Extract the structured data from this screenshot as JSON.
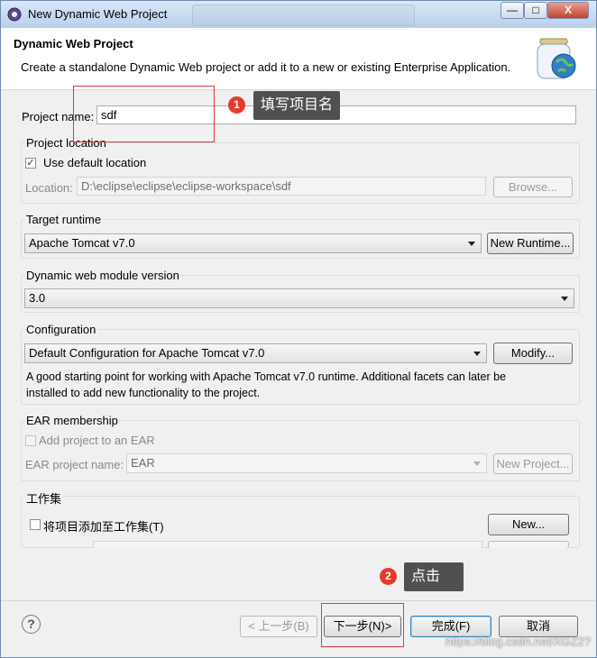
{
  "window": {
    "title": "New Dynamic Web Project",
    "minimize": "—",
    "maximize": "□",
    "close": "X"
  },
  "header": {
    "title": "Dynamic Web Project",
    "description": "Create a standalone Dynamic Web project or add it to a new or existing Enterprise Application."
  },
  "project_name": {
    "label": "Project name:",
    "value": "sdf"
  },
  "project_location": {
    "label": "Project location",
    "use_default_label": "Use default location",
    "use_default_checked": true,
    "location_label": "Location:",
    "location_value": "D:\\eclipse\\eclipse\\eclipse-workspace\\sdf",
    "browse_label": "Browse..."
  },
  "target_runtime": {
    "label": "Target runtime",
    "selected": "Apache Tomcat v7.0",
    "new_runtime_label": "New Runtime..."
  },
  "module_version": {
    "label": "Dynamic web module version",
    "selected": "3.0"
  },
  "configuration": {
    "label": "Configuration",
    "selected": "Default Configuration for Apache Tomcat v7.0",
    "modify_label": "Modify...",
    "description_line1": "A good starting point for working with Apache Tomcat v7.0 runtime. Additional facets can later be",
    "description_line2": "installed to add new functionality to the project."
  },
  "ear": {
    "label": "EAR membership",
    "add_label": "Add project to an EAR",
    "name_label": "EAR project name:",
    "name_value": "EAR",
    "new_project_label": "New Project..."
  },
  "working_set": {
    "label": "工作集",
    "add_label": "将项目添加至工作集(T)",
    "new_label": "New..."
  },
  "annotations": {
    "step1_num": "1",
    "step1_text": "填写项目名",
    "step2_num": "2",
    "step2_text": "点击"
  },
  "footer": {
    "help": "?",
    "back_label": "< 上一步(B)",
    "next_label": "下一步(N)>",
    "finish_label": "完成(F)",
    "cancel_label": "取消"
  },
  "watermark": "https://blog.csdn.net/XGZ2?"
}
